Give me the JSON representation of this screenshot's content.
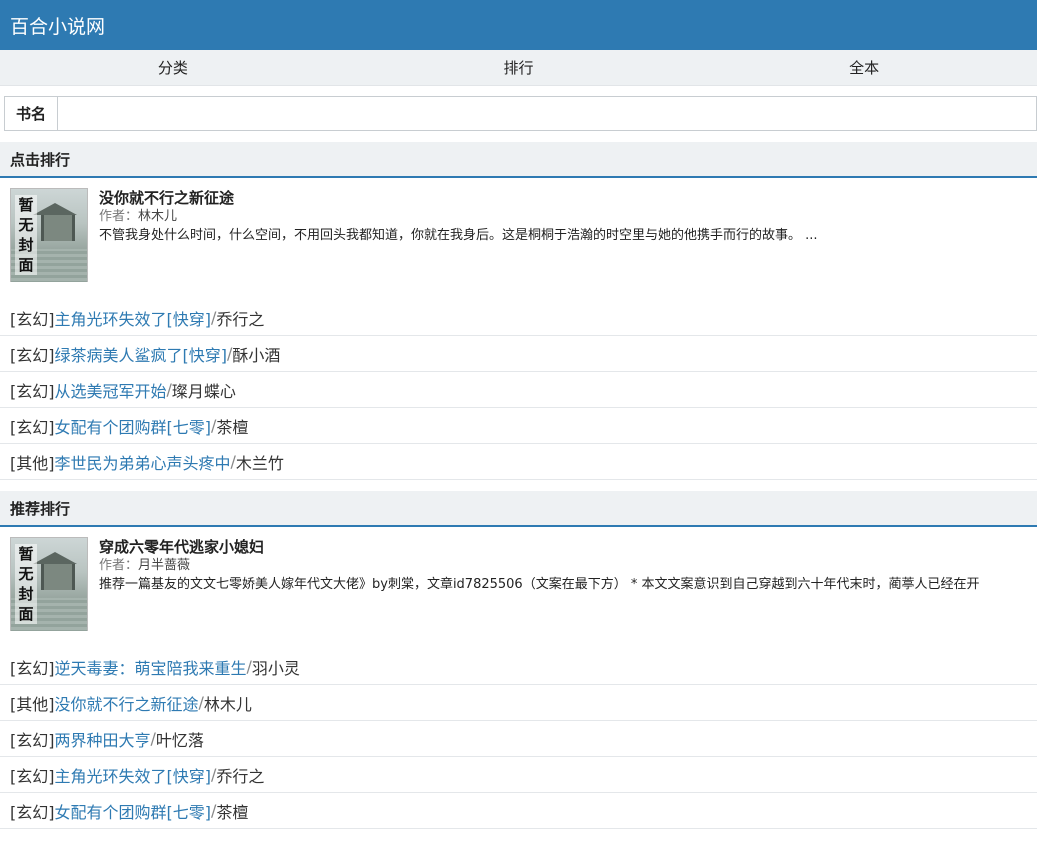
{
  "header": {
    "title": "百合小说网"
  },
  "nav": {
    "items": [
      "分类",
      "排行",
      "全本"
    ]
  },
  "search": {
    "label": "书名",
    "value": "",
    "placeholder": ""
  },
  "sections": [
    {
      "title": "点击排行",
      "featured": {
        "cover_text": "暂无封面",
        "title": "没你就不行之新征途",
        "author_label": "作者：",
        "author": "林木儿",
        "desc": "不管我身处什么时间，什么空间，不用回头我都知道，你就在我身后。这是桐桐于浩瀚的时空里与她的他携手而行的故事。 ..."
      },
      "rows": [
        {
          "cat": "[玄幻]",
          "title": "主角光环失效了[快穿]",
          "author": "乔行之"
        },
        {
          "cat": "[玄幻]",
          "title": "绿茶病美人鲨疯了[快穿]",
          "author": "酥小酒"
        },
        {
          "cat": "[玄幻]",
          "title": "从选美冠军开始",
          "author": "璨月蝶心"
        },
        {
          "cat": "[玄幻]",
          "title": "女配有个团购群[七零]",
          "author": "茶檀"
        },
        {
          "cat": "[其他]",
          "title": "李世民为弟弟心声头疼中",
          "author": "木兰竹"
        }
      ]
    },
    {
      "title": "推荐排行",
      "featured": {
        "cover_text": "暂无封面",
        "title": "穿成六零年代逃家小媳妇",
        "author_label": "作者：",
        "author": "月半蔷薇",
        "desc": "推荐一篇基友的文文七零娇美人嫁年代文大佬》by刺棠，文章id7825506（文案在最下方） * 本文文案意识到自己穿越到六十年代末时，蔺葶人已经在开"
      },
      "rows": [
        {
          "cat": "[玄幻]",
          "title": "逆天毒妻：萌宝陪我来重生",
          "author": "羽小灵"
        },
        {
          "cat": "[其他]",
          "title": "没你就不行之新征途",
          "author": "林木儿"
        },
        {
          "cat": "[玄幻]",
          "title": "两界种田大亨",
          "author": "叶忆落"
        },
        {
          "cat": "[玄幻]",
          "title": "主角光环失效了[快穿]",
          "author": "乔行之"
        },
        {
          "cat": "[玄幻]",
          "title": "女配有个团购群[七零]",
          "author": "茶檀"
        }
      ]
    }
  ],
  "colors": {
    "brand": "#2e7ab2",
    "link": "#2e7ab2",
    "section_bg": "#eef1f3"
  }
}
